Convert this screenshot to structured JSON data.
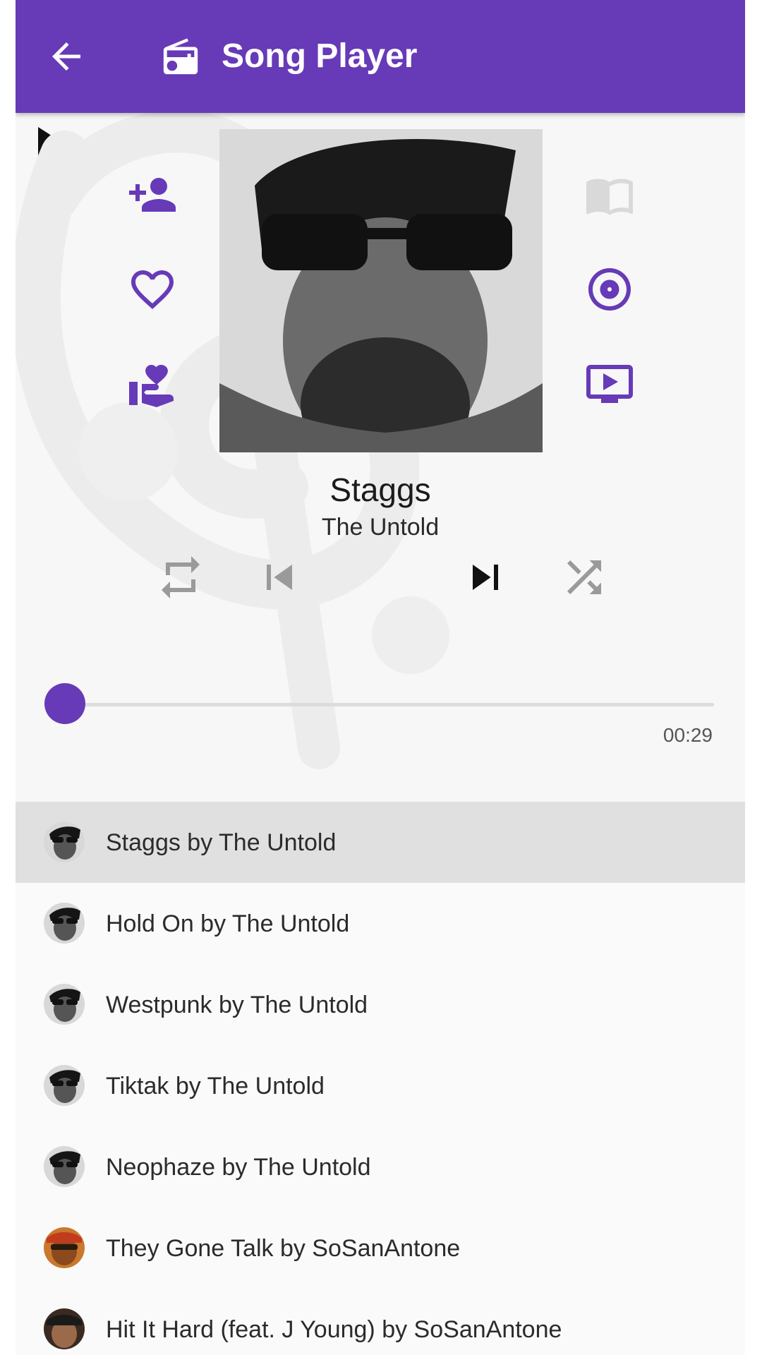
{
  "appbar": {
    "title": "Song Player",
    "background_color": "#673ab7",
    "back_icon": "arrow-left-icon",
    "title_icon": "radio-icon"
  },
  "player": {
    "song_title": "Staggs",
    "artist": "The Untold",
    "elapsed_time": "00:29",
    "progress_fraction": 0.0,
    "accent_color": "#673ab7",
    "left_actions": [
      "add-person-icon",
      "heart-outline-icon",
      "hand-heart-icon"
    ],
    "right_actions": [
      "book-open-icon",
      "vinyl-disc-icon",
      "video-play-icon"
    ],
    "controls": [
      "repeat-icon",
      "skip-previous-icon",
      "play-icon",
      "skip-next-icon",
      "shuffle-icon"
    ]
  },
  "playlist": [
    {
      "label": "Staggs by The Untold",
      "active": true
    },
    {
      "label": "Hold On by The Untold",
      "active": false
    },
    {
      "label": "Westpunk by The Untold",
      "active": false
    },
    {
      "label": "Tiktak by The Untold",
      "active": false
    },
    {
      "label": "Neophaze by The Untold",
      "active": false
    },
    {
      "label": "They Gone Talk by SoSanAntone",
      "active": false
    },
    {
      "label": "Hit It Hard (feat. J Young) by SoSanAntone",
      "active": false
    }
  ]
}
